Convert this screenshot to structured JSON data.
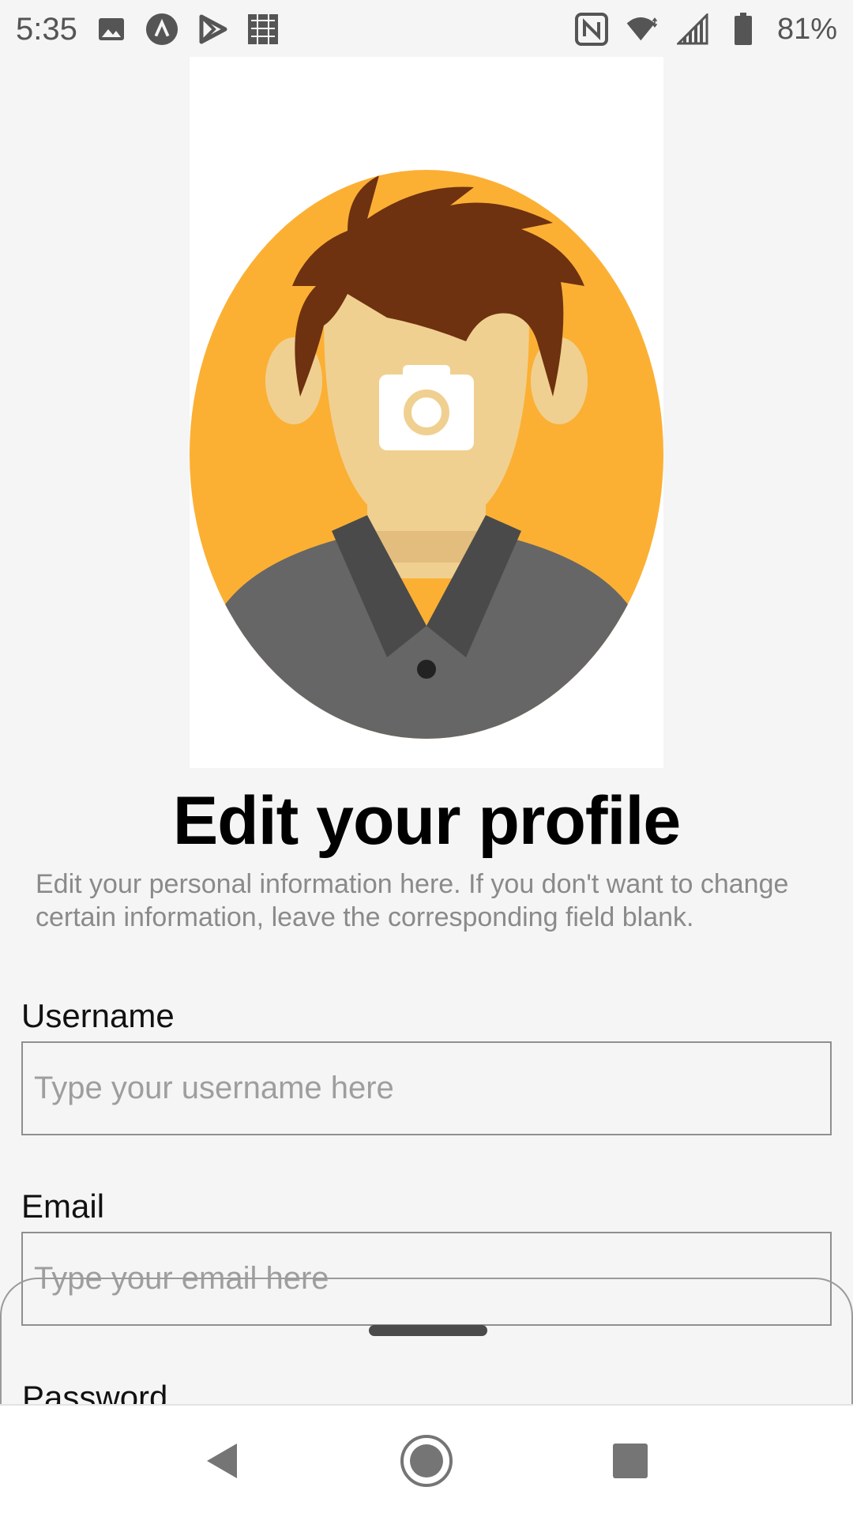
{
  "status_bar": {
    "time": "5:35",
    "battery_percent": "81%",
    "icons_left": [
      "gallery-icon",
      "arrow-app-icon",
      "play-store-icon",
      "widget-icon"
    ],
    "icons_right": [
      "nfc-icon",
      "wifi-icon",
      "signal-icon",
      "battery-icon"
    ]
  },
  "profile": {
    "avatar_icon": "camera-icon",
    "title": "Edit your profile",
    "subtitle": "Edit your personal information here. If you don't want to change certain information, leave the corresponding field blank."
  },
  "form": {
    "username": {
      "label": "Username",
      "placeholder": "Type your username here",
      "value": ""
    },
    "email": {
      "label": "Email",
      "placeholder": "Type your email here",
      "value": ""
    },
    "password": {
      "label": "Password"
    }
  },
  "nav": {
    "buttons": [
      "back-icon",
      "home-icon",
      "recents-icon"
    ]
  },
  "colors": {
    "background": "#f5f5f5",
    "avatar_circle": "#fbb034",
    "hair": "#6e3210",
    "skin": "#f0d090",
    "shirt": "#666666"
  }
}
